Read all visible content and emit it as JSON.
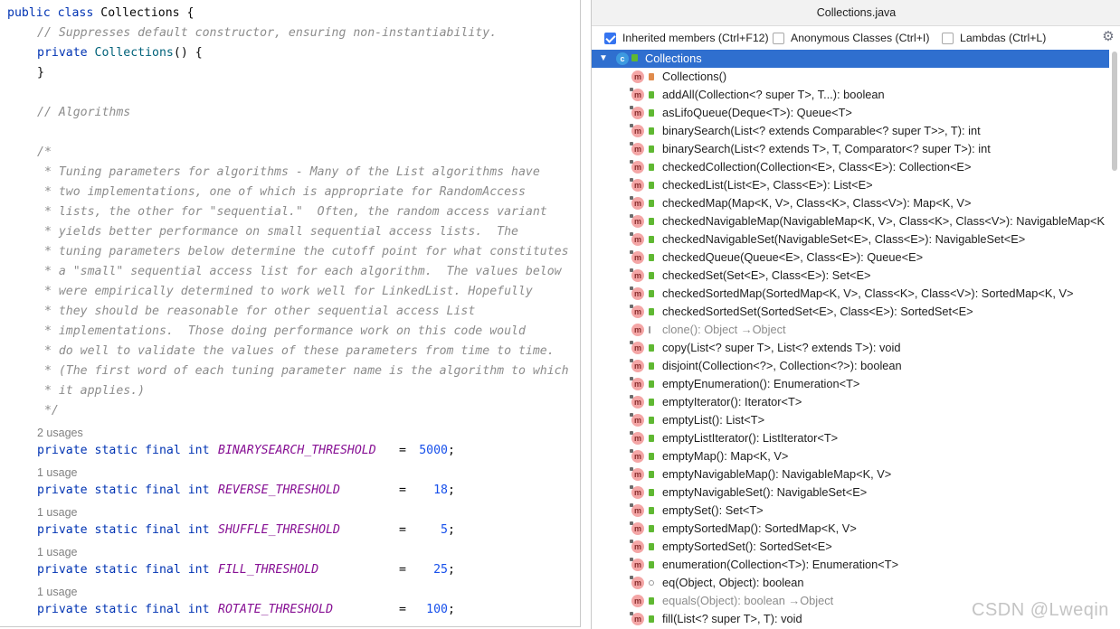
{
  "editor": {
    "class_line": {
      "kw1": "public",
      "kw2": "class",
      "name": "Collections {"
    },
    "comment1": "// Suppresses default constructor, ensuring non-instantiability.",
    "ctor": {
      "kw": "private",
      "name": "Collections",
      "rest": "() {"
    },
    "ctor_close": "}",
    "comment_alg": "// Algorithms",
    "javadoc": [
      "/*",
      " * Tuning parameters for algorithms - Many of the List algorithms have",
      " * two implementations, one of which is appropriate for RandomAccess",
      " * lists, the other for \"sequential.\"  Often, the random access variant",
      " * yields better performance on small sequential access lists.  The",
      " * tuning parameters below determine the cutoff point for what constitutes",
      " * a \"small\" sequential access list for each algorithm.  The values below",
      " * were empirically determined to work well for LinkedList. Hopefully",
      " * they should be reasonable for other sequential access List",
      " * implementations.  Those doing performance work on this code would",
      " * do well to validate the values of these parameters from time to time.",
      " * (The first word of each tuning parameter name is the algorithm to which",
      " * it applies.)",
      " */"
    ],
    "fields": [
      {
        "usage": "2 usages",
        "decl": "private static final int",
        "name": "BINARYSEARCH_THRESHOLD",
        "eq": "=",
        "value": "5000",
        "semi": ";"
      },
      {
        "usage": "1 usage",
        "decl": "private static final int",
        "name": "REVERSE_THRESHOLD",
        "eq": "=",
        "value": "18",
        "semi": ";"
      },
      {
        "usage": "1 usage",
        "decl": "private static final int",
        "name": "SHUFFLE_THRESHOLD",
        "eq": "=",
        "value": "5",
        "semi": ";"
      },
      {
        "usage": "1 usage",
        "decl": "private static final int",
        "name": "FILL_THRESHOLD",
        "eq": "=",
        "value": "25",
        "semi": ";"
      },
      {
        "usage": "1 usage",
        "decl": "private static final int",
        "name": "ROTATE_THRESHOLD",
        "eq": "=",
        "value": "100",
        "semi": ";"
      }
    ]
  },
  "structure": {
    "title": "Collections.java",
    "options": [
      {
        "label": "Inherited members (Ctrl+F12)",
        "checked": true
      },
      {
        "label": "Anonymous Classes (Ctrl+I)",
        "checked": false
      },
      {
        "label": "Lambdas (Ctrl+L)",
        "checked": false
      }
    ],
    "settings_icon": "gear-icon",
    "root": {
      "label": "Collections",
      "icon": "class-icon",
      "expanded": true
    },
    "members": [
      {
        "label": "Collections()",
        "vis": "priv",
        "static": false,
        "gray": false
      },
      {
        "label": "addAll(Collection<? super T>, T...): boolean",
        "vis": "pub",
        "static": true,
        "gray": false
      },
      {
        "label": "asLifoQueue(Deque<T>): Queue<T>",
        "vis": "pub",
        "static": true,
        "gray": false
      },
      {
        "label": "binarySearch(List<? extends Comparable<? super T>>, T): int",
        "vis": "pub",
        "static": true,
        "gray": false
      },
      {
        "label": "binarySearch(List<? extends T>, T, Comparator<? super T>): int",
        "vis": "pub",
        "static": true,
        "gray": false
      },
      {
        "label": "checkedCollection(Collection<E>, Class<E>): Collection<E>",
        "vis": "pub",
        "static": true,
        "gray": false
      },
      {
        "label": "checkedList(List<E>, Class<E>): List<E>",
        "vis": "pub",
        "static": true,
        "gray": false
      },
      {
        "label": "checkedMap(Map<K, V>, Class<K>, Class<V>): Map<K, V>",
        "vis": "pub",
        "static": true,
        "gray": false
      },
      {
        "label": "checkedNavigableMap(NavigableMap<K, V>, Class<K>, Class<V>): NavigableMap<K",
        "vis": "pub",
        "static": true,
        "gray": false
      },
      {
        "label": "checkedNavigableSet(NavigableSet<E>, Class<E>): NavigableSet<E>",
        "vis": "pub",
        "static": true,
        "gray": false
      },
      {
        "label": "checkedQueue(Queue<E>, Class<E>): Queue<E>",
        "vis": "pub",
        "static": true,
        "gray": false
      },
      {
        "label": "checkedSet(Set<E>, Class<E>): Set<E>",
        "vis": "pub",
        "static": true,
        "gray": false
      },
      {
        "label": "checkedSortedMap(SortedMap<K, V>, Class<K>, Class<V>): SortedMap<K, V>",
        "vis": "pub",
        "static": true,
        "gray": false
      },
      {
        "label": "checkedSortedSet(SortedSet<E>, Class<E>): SortedSet<E>",
        "vis": "pub",
        "static": true,
        "gray": false
      },
      {
        "label": "clone(): Object →Object",
        "vis": "pkg",
        "static": false,
        "gray": true
      },
      {
        "label": "copy(List<? super T>, List<? extends T>): void",
        "vis": "pub",
        "static": true,
        "gray": false
      },
      {
        "label": "disjoint(Collection<?>, Collection<?>): boolean",
        "vis": "pub",
        "static": true,
        "gray": false
      },
      {
        "label": "emptyEnumeration(): Enumeration<T>",
        "vis": "pub",
        "static": true,
        "gray": false
      },
      {
        "label": "emptyIterator(): Iterator<T>",
        "vis": "pub",
        "static": true,
        "gray": false
      },
      {
        "label": "emptyList(): List<T>",
        "vis": "pub",
        "static": true,
        "gray": false
      },
      {
        "label": "emptyListIterator(): ListIterator<T>",
        "vis": "pub",
        "static": true,
        "gray": false
      },
      {
        "label": "emptyMap(): Map<K, V>",
        "vis": "pub",
        "static": true,
        "gray": false
      },
      {
        "label": "emptyNavigableMap(): NavigableMap<K, V>",
        "vis": "pub",
        "static": true,
        "gray": false
      },
      {
        "label": "emptyNavigableSet(): NavigableSet<E>",
        "vis": "pub",
        "static": true,
        "gray": false
      },
      {
        "label": "emptySet(): Set<T>",
        "vis": "pub",
        "static": true,
        "gray": false
      },
      {
        "label": "emptySortedMap(): SortedMap<K, V>",
        "vis": "pub",
        "static": true,
        "gray": false
      },
      {
        "label": "emptySortedSet(): SortedSet<E>",
        "vis": "pub",
        "static": true,
        "gray": false
      },
      {
        "label": "enumeration(Collection<T>): Enumeration<T>",
        "vis": "pub",
        "static": true,
        "gray": false
      },
      {
        "label": "eq(Object, Object): boolean",
        "vis": "prot",
        "static": true,
        "gray": false
      },
      {
        "label": "equals(Object): boolean →Object",
        "vis": "pub",
        "static": false,
        "gray": true
      },
      {
        "label": "fill(List<? super T>, T): void",
        "vis": "pub",
        "static": true,
        "gray": false
      }
    ]
  },
  "watermark": "CSDN @Lweqin"
}
